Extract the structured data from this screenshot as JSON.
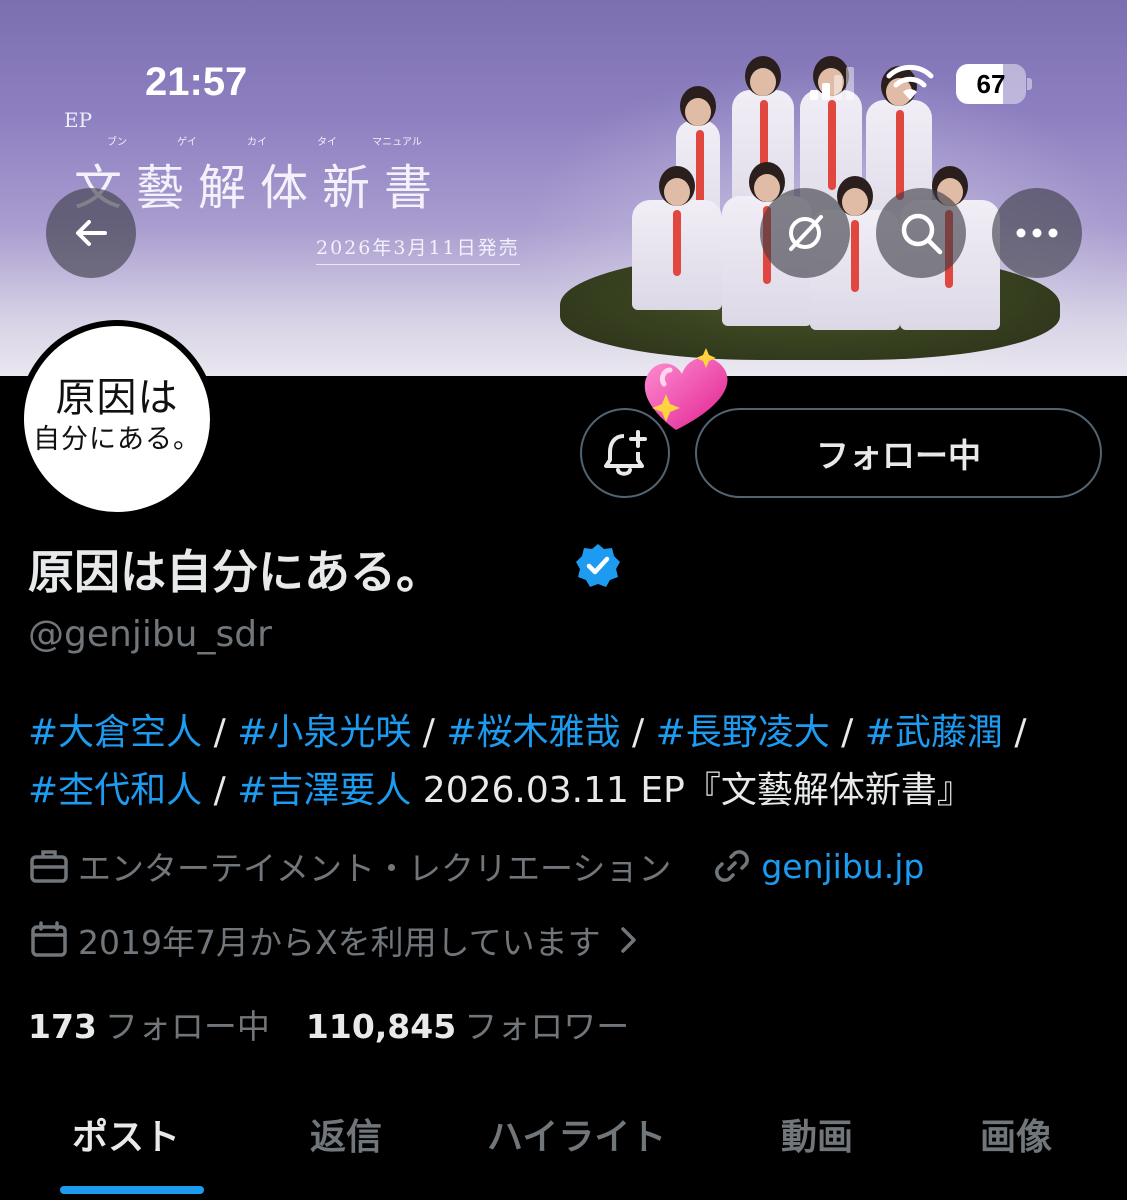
{
  "status_bar": {
    "time": "21:57",
    "battery": "67",
    "battery_level": 0.67
  },
  "banner": {
    "ep": "EP",
    "ruby": [
      "ブン",
      "ゲイ",
      "カイ",
      "タイ",
      "マニュアル"
    ],
    "album_title": "文藝解体新書",
    "release_date": "2026年3月11日発売"
  },
  "profile": {
    "avatar_logo": [
      "原因は",
      "自分にある。"
    ],
    "display_name": "原因は自分にある。",
    "handle": "@genjibu_sdr",
    "follow_label": "フォロー中",
    "bio": {
      "tags": [
        "#大倉空人",
        "#小泉光咲",
        "#桜木雅哉",
        "#長野凌大",
        "#武藤潤",
        "#杢代和人",
        "#吉澤要人"
      ],
      "separator": " / ",
      "tail": " 2026.03.11 EP『文藝解体新書』"
    },
    "category": "エンターテイメント・レクリエーション",
    "website": "genjibu.jp",
    "joined": "2019年7月からXを利用しています",
    "following_count": "173",
    "following_label": "フォロー中",
    "followers_count": "110,845",
    "followers_label": "フォロワー"
  },
  "tabs": [
    {
      "label": "ポスト",
      "active": true
    },
    {
      "label": "返信",
      "active": false
    },
    {
      "label": "ハイライト",
      "active": false
    },
    {
      "label": "動画",
      "active": false
    },
    {
      "label": "画像",
      "active": false
    }
  ],
  "colors": {
    "accent": "#1d9bf0",
    "muted": "#71767b",
    "text": "#e7e9ea",
    "border": "#536471"
  },
  "icons": [
    "back-arrow-icon",
    "grok-icon",
    "search-icon",
    "more-icon",
    "bell-plus-icon",
    "verified-badge-icon",
    "briefcase-icon",
    "link-icon",
    "calendar-icon",
    "chevron-right-icon",
    "heart-sparkle-icon"
  ]
}
